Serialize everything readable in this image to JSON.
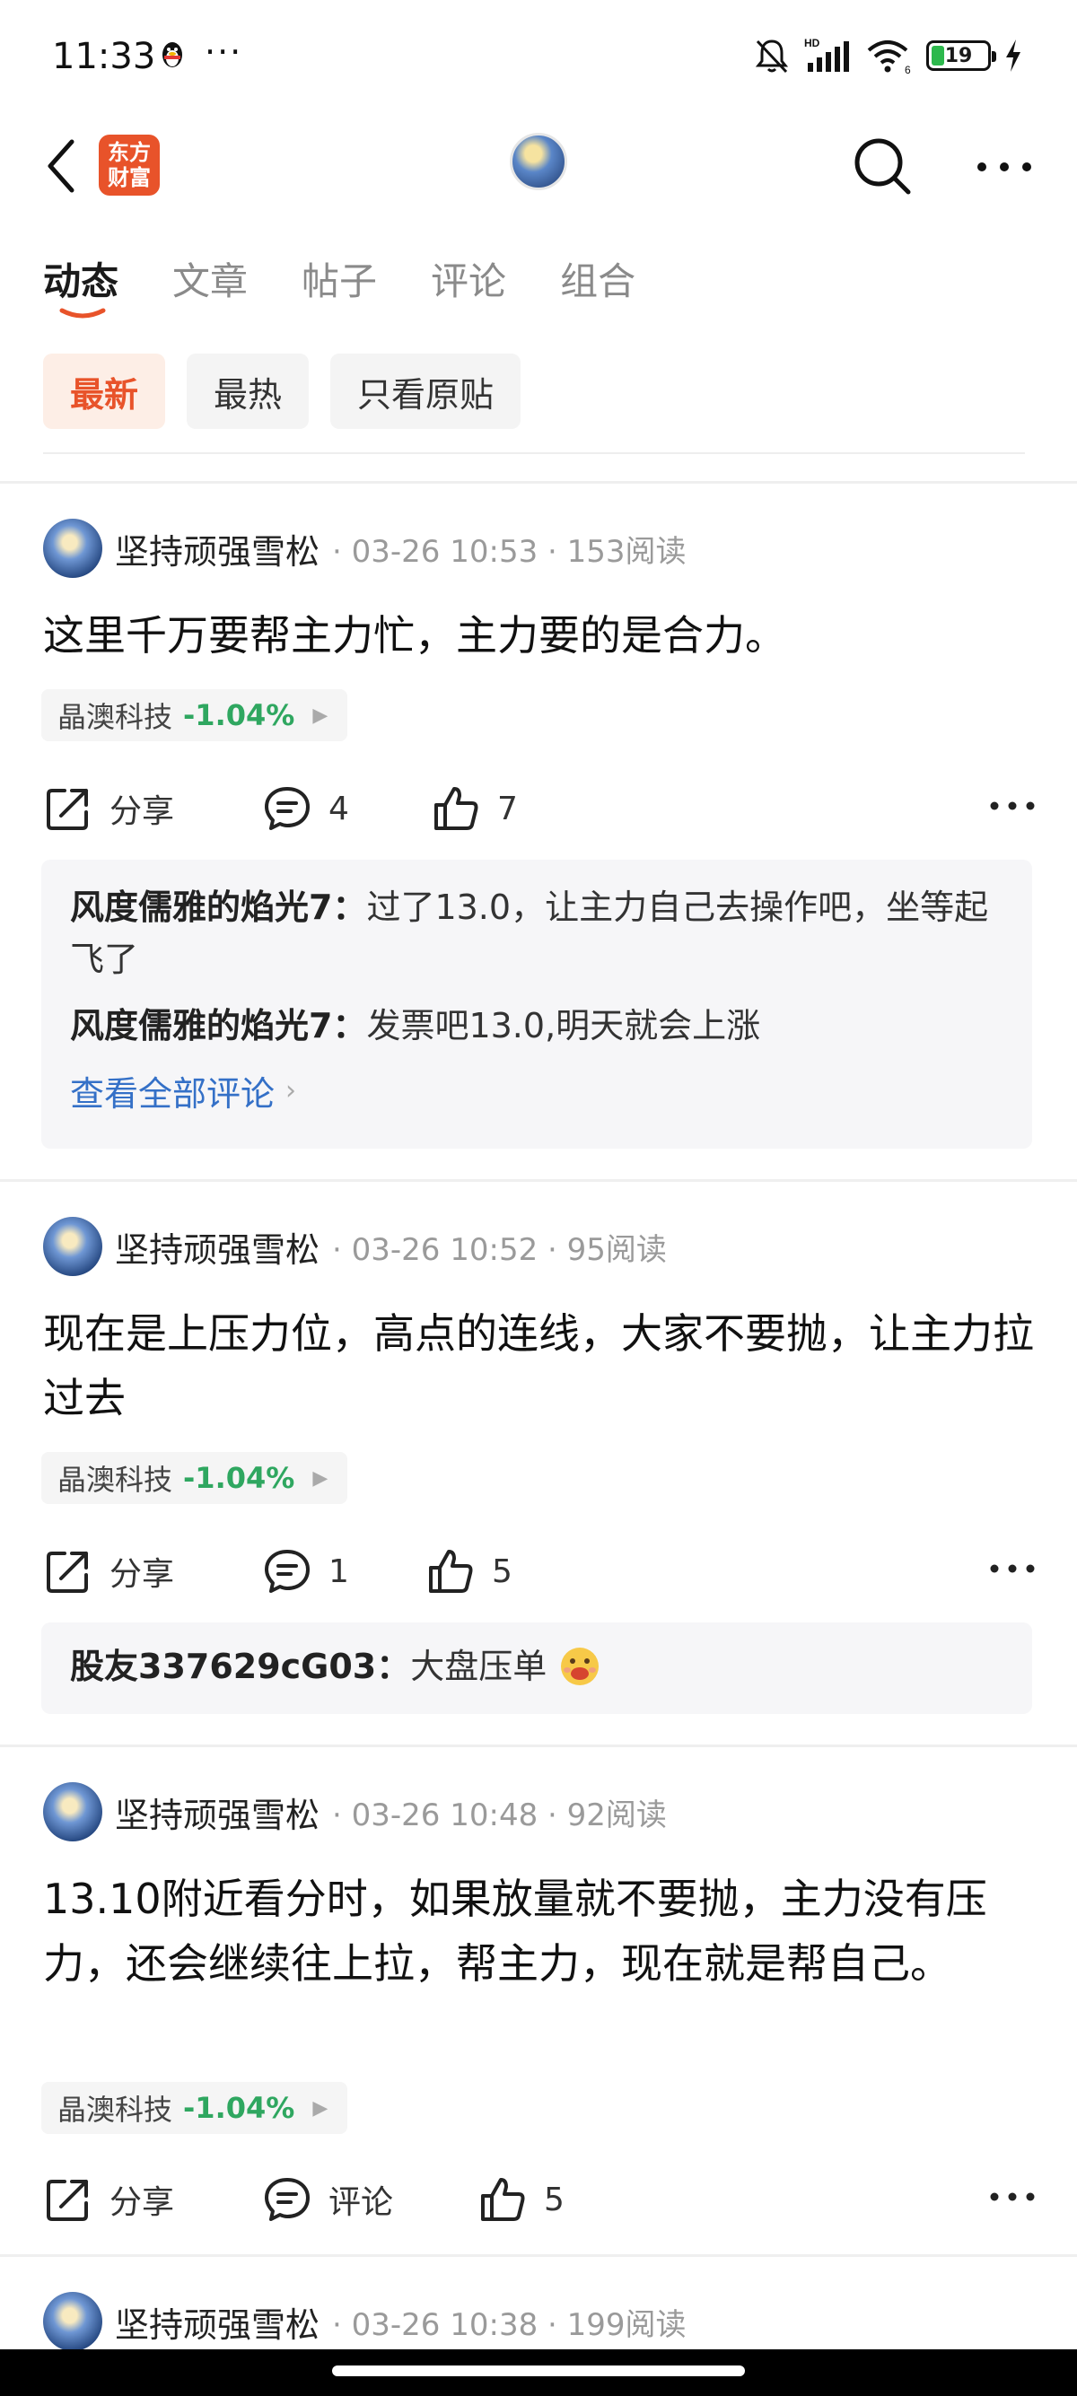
{
  "status_bar": {
    "time": "11:33",
    "battery": "19",
    "network": "HD"
  },
  "header": {
    "brand_logo_text": "东方财富",
    "icons": [
      "back-arrow-icon",
      "search-icon",
      "more-dots-icon"
    ]
  },
  "tabs": [
    {
      "label": "动态",
      "active": true
    },
    {
      "label": "文章",
      "active": false
    },
    {
      "label": "帖子",
      "active": false
    },
    {
      "label": "评论",
      "active": false
    },
    {
      "label": "组合",
      "active": false
    }
  ],
  "filters": [
    {
      "label": "最新",
      "active": true
    },
    {
      "label": "最热",
      "active": false
    },
    {
      "label": "只看原贴",
      "active": false
    }
  ],
  "posts": [
    {
      "author": "坚持顽强雪松",
      "meta": "· 03-26 10:53 · 153阅读",
      "content": "这里千万要帮主力忙，主力要的是合力。",
      "stock": {
        "name": "晶澳科技",
        "change": "-1.04%"
      },
      "actions": {
        "share": "分享",
        "comment": "4",
        "like": "7"
      },
      "comments": [
        {
          "author": "风度儒雅的焰光7：",
          "text": "过了13.0，让主力自己去操作吧，坐等起飞了"
        },
        {
          "author": "风度儒雅的焰光7：",
          "text": "发票吧13.0,明天就会上涨"
        }
      ],
      "view_all": "查看全部评论"
    },
    {
      "author": "坚持顽强雪松",
      "meta": "· 03-26 10:52 · 95阅读",
      "content": "现在是上压力位，高点的连线，大家不要抛，让主力拉过去",
      "stock": {
        "name": "晶澳科技",
        "change": "-1.04%"
      },
      "actions": {
        "share": "分享",
        "comment": "1",
        "like": "5"
      },
      "comments": [
        {
          "author": "股友337629cG03：",
          "text": "大盘压单"
        }
      ]
    },
    {
      "author": "坚持顽强雪松",
      "meta": "· 03-26 10:48 · 92阅读",
      "content": "13.10附近看分时，如果放量就不要抛，主力没有压力，还会继续往上拉，帮主力，现在就是帮自己。",
      "stock": {
        "name": "晶澳科技",
        "change": "-1.04%"
      },
      "actions": {
        "share": "分享",
        "comment": "评论",
        "like": "5"
      }
    },
    {
      "author": "坚持顽强雪松",
      "meta": "· 03-26 10:38 · 199阅读"
    }
  ],
  "colors": {
    "accent": "#e8532a",
    "stock_down": "#2fa760",
    "link": "#3470c7"
  }
}
